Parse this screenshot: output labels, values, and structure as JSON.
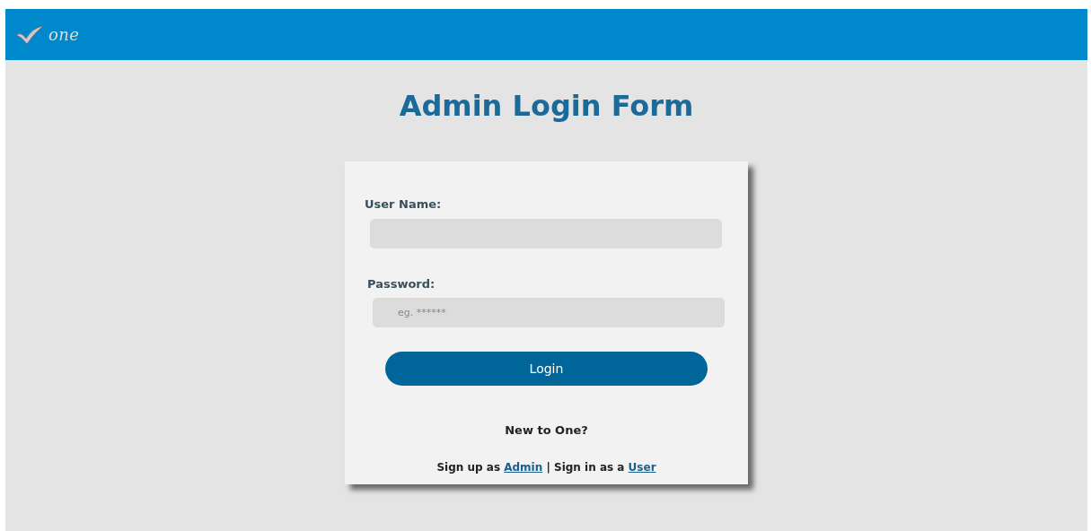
{
  "header": {
    "logo_text": "one"
  },
  "title": "Admin Login Form",
  "form": {
    "fields": [
      {
        "label": "User Name:",
        "kind": "text"
      },
      {
        "label": "Password:",
        "placeholder": "eg. ******",
        "kind": "password"
      }
    ],
    "button": "Login",
    "prompt": "New to One?",
    "links_line": [
      {
        "kind": "text",
        "text": "Sign up as "
      },
      {
        "kind": "link",
        "text": "Admin"
      },
      {
        "kind": "text",
        "text": " | Sign in as a "
      },
      {
        "kind": "link",
        "text": "User"
      }
    ]
  }
}
